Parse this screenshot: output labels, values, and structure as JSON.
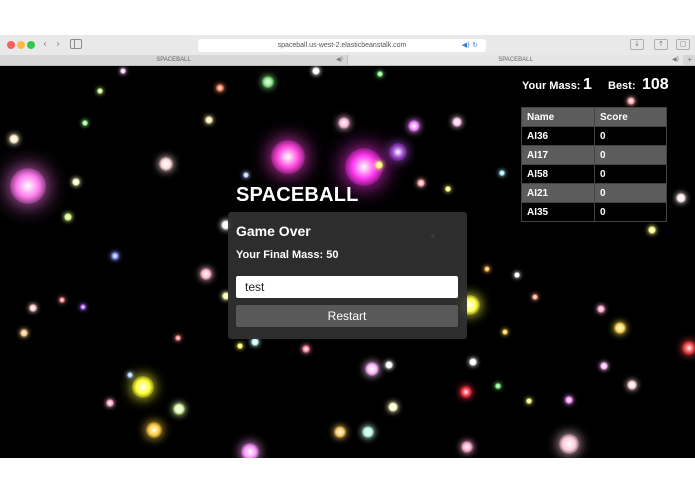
{
  "browser": {
    "url": "spaceball.us-west-2.elasticbeanstalk.com",
    "tabs": [
      {
        "label": "SPACEBALL"
      },
      {
        "label": "SPACEBALL"
      }
    ]
  },
  "hud": {
    "mass_label": "Your Mass:",
    "mass_value": "1",
    "best_label": "Best:",
    "best_value": "108"
  },
  "leaderboard": {
    "headers": [
      "Name",
      "Score"
    ],
    "rows": [
      {
        "name": "AI36",
        "score": "0"
      },
      {
        "name": "AI17",
        "score": "0"
      },
      {
        "name": "AI58",
        "score": "0"
      },
      {
        "name": "AI21",
        "score": "0"
      },
      {
        "name": "AI35",
        "score": "0"
      }
    ]
  },
  "game_over": {
    "title": "SPACEBALL",
    "heading": "Game Over",
    "final_mass": "Your Final Mass: 50",
    "name_value": "test",
    "restart_label": "Restart"
  },
  "colors": {
    "background": "#000000",
    "panel": "#303030",
    "button": "#595959",
    "leaderboard_header": "#5c5c5c"
  }
}
